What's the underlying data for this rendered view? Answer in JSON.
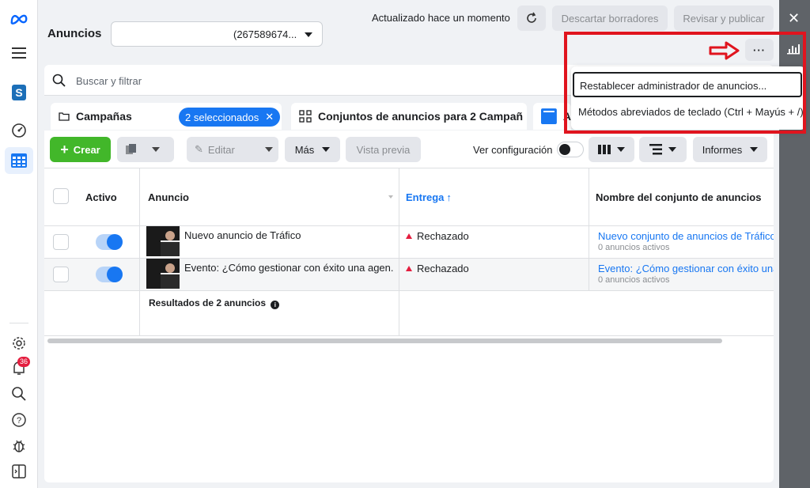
{
  "header": {
    "title": "Anuncios",
    "account_value": "(267589674...",
    "updated_text": "Actualizado hace un momento",
    "discard_label": "Descartar borradores",
    "review_label": "Revisar y publicar"
  },
  "rail": {
    "notifications_count": "36"
  },
  "search": {
    "placeholder": "Buscar y filtrar"
  },
  "tabs": {
    "campaigns": "Campañas",
    "selected_chip": "2 seleccionados",
    "adsets": "Conjuntos de anuncios para 2 Campañ",
    "ads_partial": "A"
  },
  "toolbar": {
    "create": "Crear",
    "edit": "Editar",
    "more": "Más",
    "preview": "Vista previa",
    "view_config": "Ver configuración",
    "reports": "Informes"
  },
  "table": {
    "headers": {
      "active": "Activo",
      "ad": "Anuncio",
      "delivery": "Entrega",
      "adset_name": "Nombre del conjunto de anuncios"
    },
    "rows": [
      {
        "ad": "Nuevo anuncio de Tráfico",
        "delivery": "Rechazado",
        "adset": "Nuevo conjunto de anuncios de Tráfico",
        "adset_sub": "0 anuncios activos"
      },
      {
        "ad": "Evento: ¿Cómo gestionar con éxito una agen...",
        "delivery": "Rechazado",
        "adset": "Evento: ¿Cómo gestionar con éxito una a",
        "adset_sub": "0 anuncios activos"
      }
    ],
    "summary": "Resultados de 2 anuncios"
  },
  "menu": {
    "more_glyph": "···",
    "item1": "Restablecer administrador de anuncios...",
    "item2": "Métodos abreviados de teclado (Ctrl + Mayús + /)"
  },
  "colors": {
    "accent": "#1877f2",
    "create_green": "#42b72a",
    "rejected_red": "#e41e3f",
    "highlight_red": "#e0141e"
  }
}
